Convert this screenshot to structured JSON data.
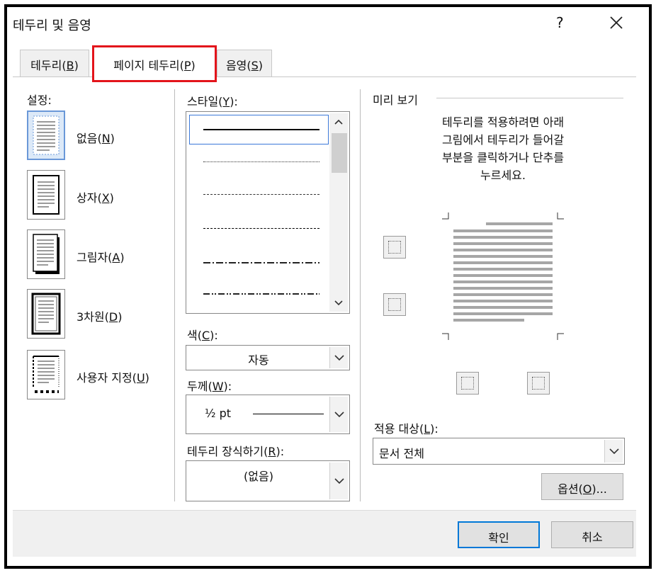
{
  "dialog": {
    "title": "테두리 및 음영",
    "help": "?",
    "close_icon": "close-icon"
  },
  "tabs": [
    {
      "label": "테두리(",
      "key": "B",
      "end": ")"
    },
    {
      "label": "페이지 테두리(",
      "key": "P",
      "end": ")"
    },
    {
      "label": "음영(",
      "key": "S",
      "end": ")"
    }
  ],
  "settings": {
    "label": "설정:",
    "items": [
      {
        "label": "없음(",
        "key": "N",
        "end": ")"
      },
      {
        "label": "상자(",
        "key": "X",
        "end": ")"
      },
      {
        "label": "그림자(",
        "key": "A",
        "end": ")"
      },
      {
        "label": "3차원(",
        "key": "D",
        "end": ")"
      },
      {
        "label": "사용자 지정(",
        "key": "U",
        "end": ")"
      }
    ]
  },
  "style": {
    "label": "스타일(",
    "key": "Y",
    "end": "):"
  },
  "color": {
    "label": "색(",
    "key": "C",
    "end": "):",
    "value": "자동"
  },
  "width": {
    "label": "두께(",
    "key": "W",
    "end": "):",
    "value": "½ pt"
  },
  "art": {
    "label": "테두리 장식하기(",
    "key": "R",
    "end": "):",
    "value": "(없음)"
  },
  "preview": {
    "label": "미리 보기",
    "hint_lines": [
      "테두리를 적용하려면 아래",
      "그림에서 테두리가 들어갈",
      "부분을 클릭하거나 단추를",
      "누르세요."
    ]
  },
  "apply_to": {
    "label": "적용 대상(",
    "key": "L",
    "end": "):",
    "value": "문서 전체"
  },
  "buttons": {
    "options": {
      "label": "옵션(",
      "key": "O",
      "end": ")..."
    },
    "ok": "확인",
    "cancel": "취소"
  },
  "colors": {
    "accent": "#0078d7",
    "highlight_box": "#e3141b"
  }
}
